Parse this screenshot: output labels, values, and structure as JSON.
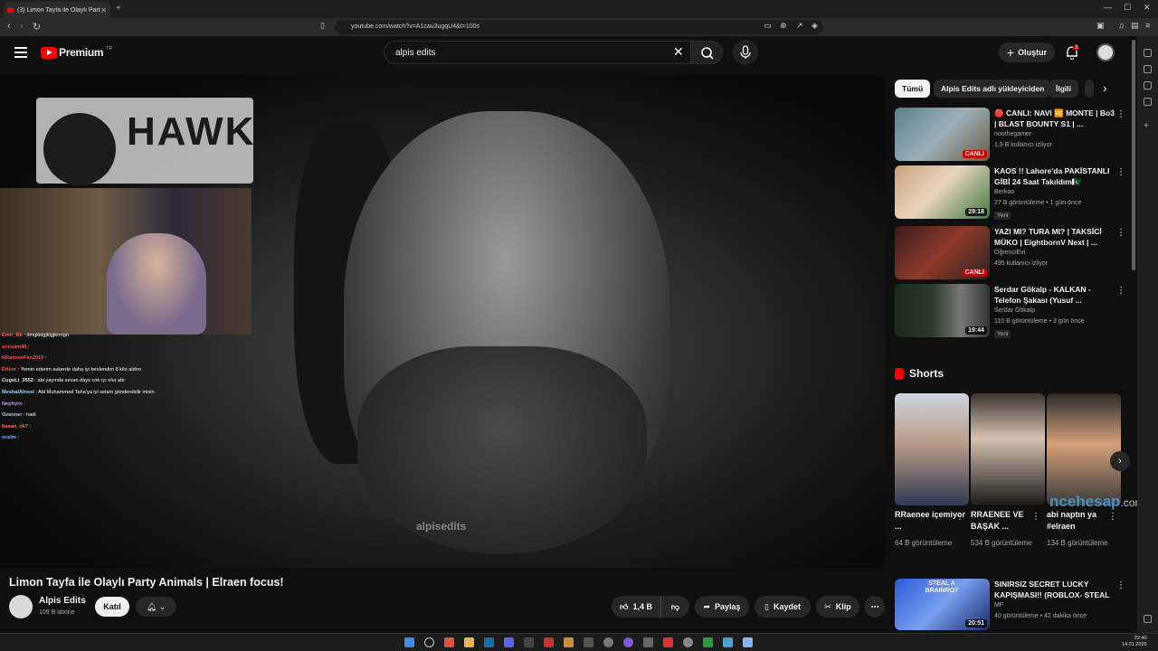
{
  "browser": {
    "tab_title": "(3) Limon Tayfa ile Olaylı Party A",
    "url": "youtube.com/watch?v=A1cau3ugqU4&t=100s"
  },
  "header": {
    "brand": "Premium",
    "country": "TR",
    "search_value": "alpis edits",
    "create_label": "Oluştur",
    "notification_count": "3"
  },
  "player": {
    "overlay_logo_text": "HAWK",
    "watermark": "alpisedits",
    "chat": [
      {
        "user": "Emir_Bk",
        "msg": "dmgkldgjklgjkrrngn",
        "color": "#f25f5c"
      },
      {
        "user": "ucozum48",
        "msg": "",
        "color": "#ff4d4d"
      },
      {
        "user": "RRaeneeFan2010",
        "msg": "",
        "color": "#ff4d4d"
      },
      {
        "user": "Erlenr",
        "msg": "Yemin ederim askerde daha iyi beslendim 8 kilo aldım",
        "color": "#ff4d4d"
      },
      {
        "user": "CuguLi_3552",
        "msg": "abi yayında sevan days cok ıyı olur abi",
        "color": "#e6e6e6"
      },
      {
        "user": "MeshalAlneel",
        "msg": "Abi Muhammed Taha'ya iyi selam gönderebilir misin",
        "color": "#9dd6ff"
      },
      {
        "user": "Nephyrn",
        "msg": "",
        "color": "#b19dff"
      },
      {
        "user": "Ozanner",
        "msg": "hadi",
        "color": "#9dd6ff"
      },
      {
        "user": "hasan_ok7",
        "msg": "",
        "color": "#ff6b6b"
      },
      {
        "user": "ecelm",
        "msg": "",
        "color": "#6fb8ff"
      }
    ]
  },
  "video": {
    "title": "Limon Tayfa ile Olaylı Party Animals | Elraen focus!",
    "channel": "Alpis Edits",
    "subscribers": "109 B abone",
    "join_label": "Katıl",
    "likes": "1,4 B",
    "share_label": "Paylaş",
    "save_label": "Kaydet",
    "clip_label": "Klip"
  },
  "chips": [
    "Tümü",
    "Alpis Edits adlı yükleyiciden",
    "İlgili"
  ],
  "recommendations": [
    {
      "title": "🔴 CANLI: NAVI 🆚 MONTE | Bo3 | BLAST BOUNTY S1 | ...",
      "channel": "noothegamer",
      "meta": "1,9 B kullanıcı izliyor",
      "badge": "CANLI",
      "new": ""
    },
    {
      "title": "KAOS !! Lahore'da PAKİSTANLI GİBİ 24 Saat Takıldım🇵🇰",
      "channel": "Berkoo",
      "meta": "27 B görüntüleme • 1 gün önce",
      "badge": "29:18",
      "new": "Yeni"
    },
    {
      "title": "YAZI MI? TURA MI? | TAKSİCİ MÜKO | EightbornV Next | ...",
      "channel": "ÖğrenciEvi",
      "meta": "495 kullanıcı izliyor",
      "badge": "CANLI",
      "new": ""
    },
    {
      "title": "Serdar Gökalp - KALKAN - Telefon Şakası (Yusuf ...",
      "channel": "Serdar Gökalp",
      "meta": "110 B görüntüleme • 3 gün önce",
      "badge": "19:44",
      "new": "Yeni"
    }
  ],
  "shorts_title": "Shorts",
  "shorts": [
    {
      "title": "RRaenee içemiyor ...",
      "views": "64 B görüntüleme"
    },
    {
      "title": "RRAENEE VE BAŞAK ...",
      "views": "534 B görüntüleme"
    },
    {
      "title": "abi naptın ya #elraen",
      "views": "134 B görüntüleme"
    }
  ],
  "bottom_rec": {
    "title": "SINIRSIZ SECRET LUCKY KAPIŞMASI!! (ROBLOX- STEAL ...",
    "channel": "MF",
    "meta": "40 görüntüleme • 42 dakika önce",
    "badge": "20:51",
    "thumb_text": "STEAL A BRAINROT"
  },
  "site_watermark": {
    "main": "ncehesap",
    "suffix": ".com"
  },
  "clock": {
    "time": "22:40",
    "date": "14.01.2026"
  }
}
